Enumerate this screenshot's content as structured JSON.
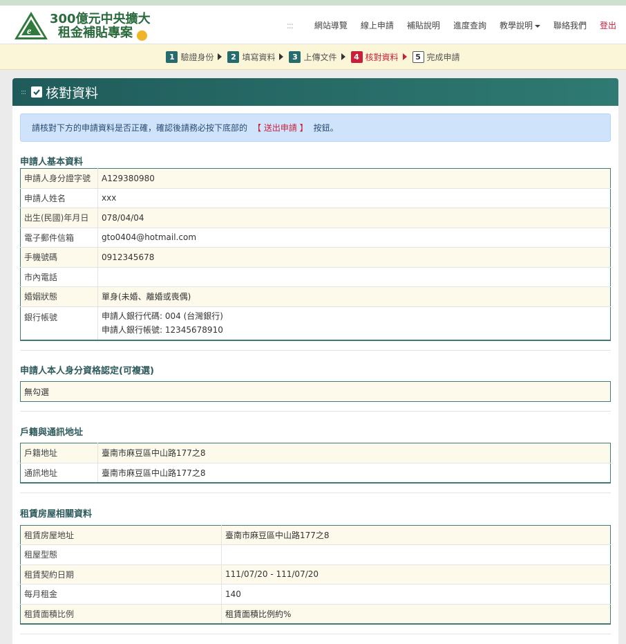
{
  "header": {
    "logo_line1": "300億元中央擴大",
    "logo_line2": "租金補貼專案",
    "nav": [
      "網站導覽",
      "線上申請",
      "補貼說明",
      "進度查詢",
      "教學說明",
      "聯絡我們"
    ],
    "logout": "登出"
  },
  "steps": [
    {
      "num": "1",
      "label": "驗證身份"
    },
    {
      "num": "2",
      "label": "填寫資料"
    },
    {
      "num": "3",
      "label": "上傳文件"
    },
    {
      "num": "4",
      "label": "核對資料"
    },
    {
      "num": "5",
      "label": "完成申請"
    }
  ],
  "panel": {
    "title": "核對資料",
    "notice_pre": "請核對下方的申請資料是否正確，確認後請務必按下底部的",
    "notice_highlight": "【 送出申請 】",
    "notice_post": "按鈕。"
  },
  "applicant": {
    "title": "申請人基本資料",
    "rows": [
      {
        "label": "申請人身分證字號",
        "value": "A129380980"
      },
      {
        "label": "申請人姓名",
        "value": "xxx"
      },
      {
        "label": "出生(民國)年月日",
        "value": "078/04/04"
      },
      {
        "label": "電子郵件信箱",
        "value": "gto0404@hotmail.com"
      },
      {
        "label": "手機號碼",
        "value": "0912345678"
      },
      {
        "label": "市內電話",
        "value": ""
      },
      {
        "label": "婚姻狀態",
        "value": "單身(未婚、離婚或喪偶)"
      }
    ],
    "bank_label": "銀行帳號",
    "bank_line1": "申請人銀行代碼: 004 (台灣銀行)",
    "bank_line2": "申請人銀行帳號: 12345678910"
  },
  "qualification": {
    "title": "申請人本人身分資格認定(可複選)",
    "value": "無勾選"
  },
  "address": {
    "title": "戶籍與通訊地址",
    "rows": [
      {
        "label": "戶籍地址",
        "value": "臺南市麻豆區中山路177之8"
      },
      {
        "label": "通訊地址",
        "value": "臺南市麻豆區中山路177之8"
      }
    ]
  },
  "rental": {
    "title": "租賃房屋相關資料",
    "rows": [
      {
        "label": "租賃房屋地址",
        "value": "臺南市麻豆區中山路177之8"
      },
      {
        "label": "租屋型態",
        "value": ""
      },
      {
        "label": "租賃契約日期",
        "value": "111/07/20 - 111/07/20"
      },
      {
        "label": "每月租金",
        "value": "140"
      },
      {
        "label": "租賃面積比例",
        "value": "租賃面積比例約%"
      }
    ]
  },
  "colors": {
    "accent": "#266c6e",
    "active": "#c8203c",
    "row_tint": "#fdfaec",
    "notice_bg": "#cfe3fa"
  }
}
